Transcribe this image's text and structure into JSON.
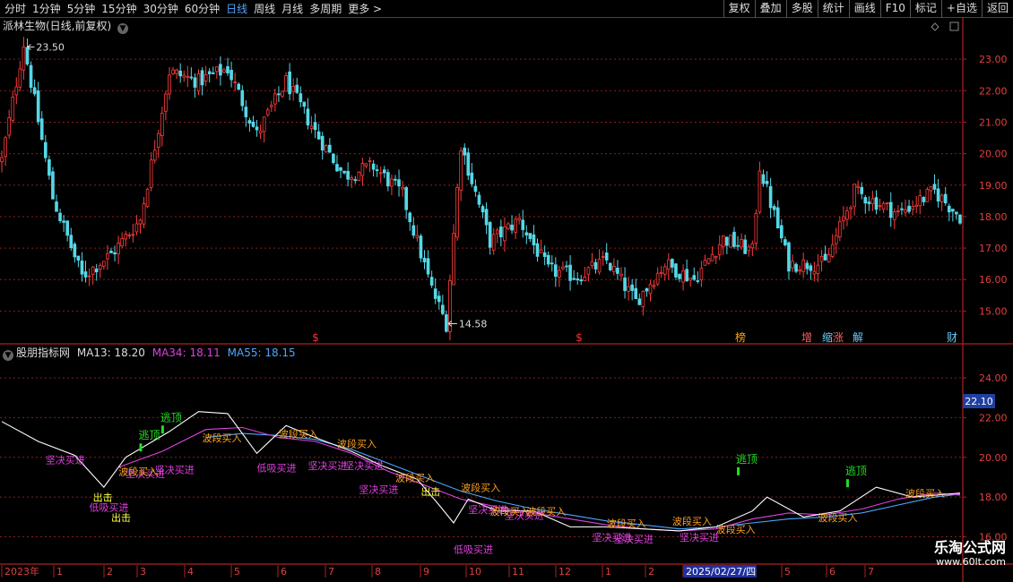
{
  "toolbar": {
    "timeframes": [
      "分时",
      "1分钟",
      "5分钟",
      "15分钟",
      "30分钟",
      "60分钟",
      "日线",
      "周线",
      "月线",
      "多周期",
      "更多 >"
    ],
    "active_index": 6,
    "tools": [
      "复权",
      "叠加",
      "多股",
      "统计",
      "画线",
      "F10",
      "标记",
      "+自选",
      "返回"
    ]
  },
  "main_panel": {
    "title": "派林生物(日线,前复权)",
    "price_high_label": "23.50",
    "price_low_label": "14.58",
    "y_ticks": [
      "23.00",
      "22.00",
      "21.00",
      "20.00",
      "19.00",
      "18.00",
      "17.00",
      "16.00",
      "15.00"
    ],
    "event_markers": [
      {
        "text": "$",
        "color": "#ff3030"
      },
      {
        "text": "$",
        "color": "#ff3030"
      },
      {
        "text": "榜",
        "color": "#ffa500"
      },
      {
        "text": "增",
        "color": "#ff6060"
      },
      {
        "text": "缩",
        "color": "#66ccff"
      },
      {
        "text": "涨",
        "color": "#ff6060"
      },
      {
        "text": "解",
        "color": "#66ccff"
      },
      {
        "text": "财",
        "color": "#66ccff"
      }
    ]
  },
  "indicator_panel": {
    "name": "股朋指标网",
    "ma13_label": "MA13:",
    "ma13_value": "18.20",
    "ma34_label": "MA34:",
    "ma34_value": "18.11",
    "ma55_label": "MA55:",
    "ma55_value": "18.15",
    "y_ticks": [
      "24.00",
      "22.00",
      "20.00",
      "18.00",
      "16.00"
    ],
    "current_value": "22.10",
    "signals": {
      "top": "逃顶",
      "buy_segment": "波段买入",
      "buy_decisive": "坚决买进",
      "buy_absorb": "低吸买进",
      "strike": "出击",
      "buy_decisive_short": "坚决买",
      "buy_segment_short": "波段买"
    }
  },
  "time_axis": {
    "labels": [
      "2023年",
      "1",
      "2",
      "3",
      "4",
      "5",
      "6",
      "7",
      "8",
      "9",
      "10",
      "11",
      "12",
      "1",
      "2",
      "2025/02/27/四",
      "5",
      "6",
      "7"
    ]
  },
  "watermark": {
    "line1": "乐淘公式网",
    "line2": "www.60lt.com"
  },
  "colors": {
    "up": "#ff3c3c",
    "down": "#54d8e8",
    "grid": "#8b1e1e",
    "ma13": "#ffffff",
    "ma34": "#e040e0",
    "ma55": "#4aa8ff",
    "signal_top": "#22dd22",
    "signal_segment": "#ffa020",
    "signal_decisive": "#e040e0",
    "signal_strike": "#ffff40"
  },
  "chart_data": {
    "type": "candlestick",
    "ylim": [
      14.3,
      23.8
    ],
    "indicator_ylim": [
      15.8,
      24.9
    ],
    "events": [
      {
        "x": 0,
        "y": 19.8
      },
      {
        "x": 6,
        "y": 23.5
      },
      {
        "x": 14,
        "y": 18.6
      },
      {
        "x": 22,
        "y": 16.1
      },
      {
        "x": 30,
        "y": 16.8
      },
      {
        "x": 38,
        "y": 17.9
      },
      {
        "x": 46,
        "y": 22.6
      },
      {
        "x": 54,
        "y": 22.3
      },
      {
        "x": 62,
        "y": 22.7
      },
      {
        "x": 70,
        "y": 20.6
      },
      {
        "x": 78,
        "y": 22.3
      },
      {
        "x": 86,
        "y": 20.7
      },
      {
        "x": 94,
        "y": 19.3
      },
      {
        "x": 102,
        "y": 19.6
      },
      {
        "x": 110,
        "y": 18.7
      },
      {
        "x": 118,
        "y": 15.7
      },
      {
        "x": 122,
        "y": 14.6
      },
      {
        "x": 126,
        "y": 20.3
      },
      {
        "x": 134,
        "y": 17.2
      },
      {
        "x": 142,
        "y": 17.9
      },
      {
        "x": 150,
        "y": 16.3
      },
      {
        "x": 158,
        "y": 16.1
      },
      {
        "x": 166,
        "y": 16.6
      },
      {
        "x": 174,
        "y": 15.3
      },
      {
        "x": 182,
        "y": 16.5
      },
      {
        "x": 190,
        "y": 16.0
      },
      {
        "x": 198,
        "y": 17.3
      },
      {
        "x": 206,
        "y": 16.9
      },
      {
        "x": 208,
        "y": 19.6
      },
      {
        "x": 216,
        "y": 16.5
      },
      {
        "x": 226,
        "y": 16.5
      },
      {
        "x": 234,
        "y": 18.8
      },
      {
        "x": 246,
        "y": 18.1
      },
      {
        "x": 256,
        "y": 18.8
      },
      {
        "x": 263,
        "y": 18.0
      }
    ],
    "ma13": [
      {
        "x": 0,
        "y": 21.8
      },
      {
        "x": 10,
        "y": 20.8
      },
      {
        "x": 20,
        "y": 20.1
      },
      {
        "x": 28,
        "y": 18.5
      },
      {
        "x": 34,
        "y": 20.0
      },
      {
        "x": 46,
        "y": 21.3
      },
      {
        "x": 54,
        "y": 22.3
      },
      {
        "x": 62,
        "y": 22.2
      },
      {
        "x": 70,
        "y": 20.2
      },
      {
        "x": 78,
        "y": 21.6
      },
      {
        "x": 86,
        "y": 21.0
      },
      {
        "x": 96,
        "y": 20.3
      },
      {
        "x": 104,
        "y": 19.6
      },
      {
        "x": 114,
        "y": 18.9
      },
      {
        "x": 120,
        "y": 17.6
      },
      {
        "x": 124,
        "y": 16.7
      },
      {
        "x": 128,
        "y": 17.9
      },
      {
        "x": 136,
        "y": 17.3
      },
      {
        "x": 146,
        "y": 17.3
      },
      {
        "x": 156,
        "y": 16.5
      },
      {
        "x": 166,
        "y": 16.5
      },
      {
        "x": 176,
        "y": 16.4
      },
      {
        "x": 186,
        "y": 16.3
      },
      {
        "x": 196,
        "y": 16.5
      },
      {
        "x": 206,
        "y": 17.3
      },
      {
        "x": 210,
        "y": 18.0
      },
      {
        "x": 220,
        "y": 17.0
      },
      {
        "x": 230,
        "y": 17.3
      },
      {
        "x": 240,
        "y": 18.5
      },
      {
        "x": 250,
        "y": 18.0
      },
      {
        "x": 263,
        "y": 18.2
      }
    ],
    "ma34": [
      {
        "x": 32,
        "y": 19.5
      },
      {
        "x": 44,
        "y": 20.3
      },
      {
        "x": 56,
        "y": 21.4
      },
      {
        "x": 66,
        "y": 21.5
      },
      {
        "x": 76,
        "y": 21.0
      },
      {
        "x": 86,
        "y": 20.8
      },
      {
        "x": 96,
        "y": 20.2
      },
      {
        "x": 106,
        "y": 19.3
      },
      {
        "x": 116,
        "y": 18.6
      },
      {
        "x": 126,
        "y": 17.9
      },
      {
        "x": 136,
        "y": 17.5
      },
      {
        "x": 146,
        "y": 17.2
      },
      {
        "x": 156,
        "y": 16.9
      },
      {
        "x": 166,
        "y": 16.6
      },
      {
        "x": 176,
        "y": 16.4
      },
      {
        "x": 186,
        "y": 16.3
      },
      {
        "x": 196,
        "y": 16.4
      },
      {
        "x": 206,
        "y": 16.9
      },
      {
        "x": 216,
        "y": 17.2
      },
      {
        "x": 226,
        "y": 17.1
      },
      {
        "x": 236,
        "y": 17.4
      },
      {
        "x": 246,
        "y": 17.9
      },
      {
        "x": 256,
        "y": 18.2
      },
      {
        "x": 263,
        "y": 18.1
      }
    ],
    "ma55": [
      {
        "x": 56,
        "y": 21.0
      },
      {
        "x": 66,
        "y": 21.2
      },
      {
        "x": 76,
        "y": 21.1
      },
      {
        "x": 86,
        "y": 20.9
      },
      {
        "x": 96,
        "y": 20.4
      },
      {
        "x": 106,
        "y": 19.7
      },
      {
        "x": 116,
        "y": 19.0
      },
      {
        "x": 126,
        "y": 18.3
      },
      {
        "x": 136,
        "y": 17.8
      },
      {
        "x": 146,
        "y": 17.4
      },
      {
        "x": 156,
        "y": 17.1
      },
      {
        "x": 166,
        "y": 16.8
      },
      {
        "x": 176,
        "y": 16.6
      },
      {
        "x": 186,
        "y": 16.4
      },
      {
        "x": 196,
        "y": 16.5
      },
      {
        "x": 206,
        "y": 16.7
      },
      {
        "x": 216,
        "y": 16.9
      },
      {
        "x": 226,
        "y": 17.0
      },
      {
        "x": 236,
        "y": 17.2
      },
      {
        "x": 246,
        "y": 17.6
      },
      {
        "x": 256,
        "y": 18.0
      },
      {
        "x": 263,
        "y": 18.15
      }
    ],
    "signals": [
      {
        "x": 44,
        "y": 21.6,
        "kind": "top"
      },
      {
        "x": 38,
        "y": 20.7,
        "kind": "top"
      },
      {
        "x": 202,
        "y": 19.5,
        "kind": "top"
      },
      {
        "x": 232,
        "y": 18.9,
        "kind": "top"
      },
      {
        "x": 12,
        "y": 19.7,
        "kind": "decisive"
      },
      {
        "x": 34,
        "y": 19.0,
        "kind": "decisive"
      },
      {
        "x": 42,
        "y": 19.2,
        "kind": "decisive"
      },
      {
        "x": 84,
        "y": 19.4,
        "kind": "decisive"
      },
      {
        "x": 94,
        "y": 19.4,
        "kind": "decisive"
      },
      {
        "x": 98,
        "y": 18.2,
        "kind": "decisive"
      },
      {
        "x": 128,
        "y": 17.2,
        "kind": "decisive"
      },
      {
        "x": 138,
        "y": 16.9,
        "kind": "decisive"
      },
      {
        "x": 162,
        "y": 15.8,
        "kind": "decisive"
      },
      {
        "x": 168,
        "y": 15.7,
        "kind": "decisive"
      },
      {
        "x": 186,
        "y": 15.8,
        "kind": "decisive"
      },
      {
        "x": 24,
        "y": 17.3,
        "kind": "absorb"
      },
      {
        "x": 70,
        "y": 19.3,
        "kind": "absorb"
      },
      {
        "x": 124,
        "y": 15.2,
        "kind": "absorb"
      },
      {
        "x": 30,
        "y": 16.8,
        "kind": "strike"
      },
      {
        "x": 25,
        "y": 17.8,
        "kind": "strike"
      },
      {
        "x": 115,
        "y": 18.1,
        "kind": "strike"
      },
      {
        "x": 32,
        "y": 19.1,
        "kind": "segment"
      },
      {
        "x": 55,
        "y": 20.8,
        "kind": "segment"
      },
      {
        "x": 76,
        "y": 21.0,
        "kind": "segment"
      },
      {
        "x": 92,
        "y": 20.5,
        "kind": "segment"
      },
      {
        "x": 108,
        "y": 18.8,
        "kind": "segment"
      },
      {
        "x": 126,
        "y": 18.3,
        "kind": "segment"
      },
      {
        "x": 134,
        "y": 17.1,
        "kind": "segment"
      },
      {
        "x": 144,
        "y": 17.1,
        "kind": "segment"
      },
      {
        "x": 166,
        "y": 16.5,
        "kind": "segment"
      },
      {
        "x": 184,
        "y": 16.6,
        "kind": "segment"
      },
      {
        "x": 196,
        "y": 16.2,
        "kind": "segment"
      },
      {
        "x": 224,
        "y": 16.8,
        "kind": "segment"
      },
      {
        "x": 248,
        "y": 18.0,
        "kind": "segment"
      }
    ]
  }
}
